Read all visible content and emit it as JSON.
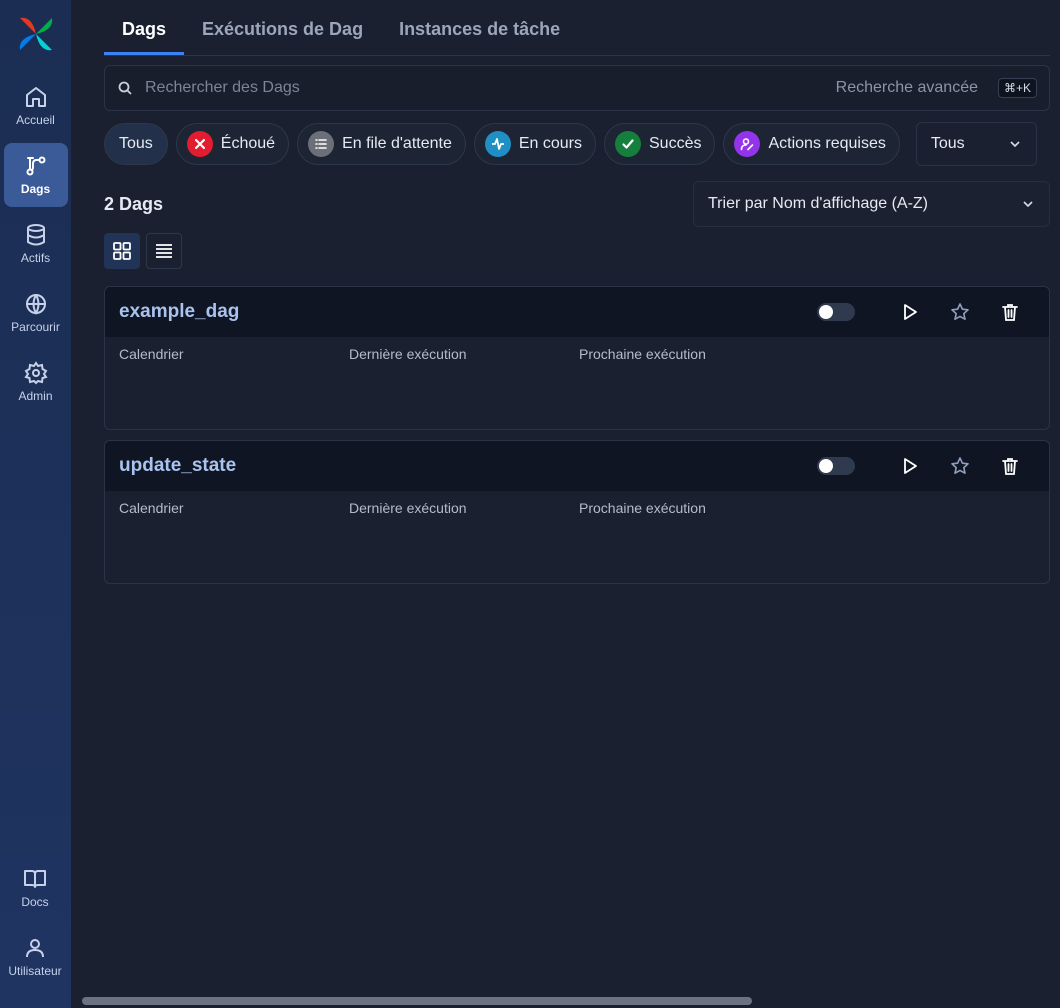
{
  "sidebar": {
    "logo": "airflow-pinwheel-logo",
    "items": [
      {
        "label": "Accueil",
        "icon": "home-icon"
      },
      {
        "label": "Dags",
        "icon": "dag-icon"
      },
      {
        "label": "Actifs",
        "icon": "database-icon"
      },
      {
        "label": "Parcourir",
        "icon": "globe-icon"
      },
      {
        "label": "Admin",
        "icon": "gear-icon"
      }
    ],
    "bottom": [
      {
        "label": "Docs",
        "icon": "book-icon"
      },
      {
        "label": "Utilisateur",
        "icon": "user-icon"
      }
    ]
  },
  "tabs": [
    {
      "label": "Dags"
    },
    {
      "label": "Exécutions de Dag"
    },
    {
      "label": "Instances de tâche"
    }
  ],
  "search": {
    "placeholder": "Rechercher des Dags",
    "advanced": "Recherche avancée",
    "shortcut": "⌘+K"
  },
  "filters": {
    "chips": [
      {
        "label": "Tous"
      },
      {
        "label": "Échoué",
        "icon": "x-icon",
        "color": "#e11d2f"
      },
      {
        "label": "En file d'attente",
        "icon": "list-icon",
        "color": "#6b6f78"
      },
      {
        "label": "En cours",
        "icon": "activity-icon",
        "color": "#1f8fc4"
      },
      {
        "label": "Succès",
        "icon": "check-icon",
        "color": "#15803d"
      },
      {
        "label": "Actions requises",
        "icon": "user-edit-icon",
        "color": "#9333ea"
      }
    ],
    "select": "Tous"
  },
  "count": "2 Dags",
  "sort": "Trier par Nom d'affichage (A-Z)",
  "dags": [
    {
      "name": "example_dag",
      "cols": [
        "Calendrier",
        "Dernière exécution",
        "Prochaine exécution"
      ]
    },
    {
      "name": "update_state",
      "cols": [
        "Calendrier",
        "Dernière exécution",
        "Prochaine exécution"
      ]
    }
  ]
}
